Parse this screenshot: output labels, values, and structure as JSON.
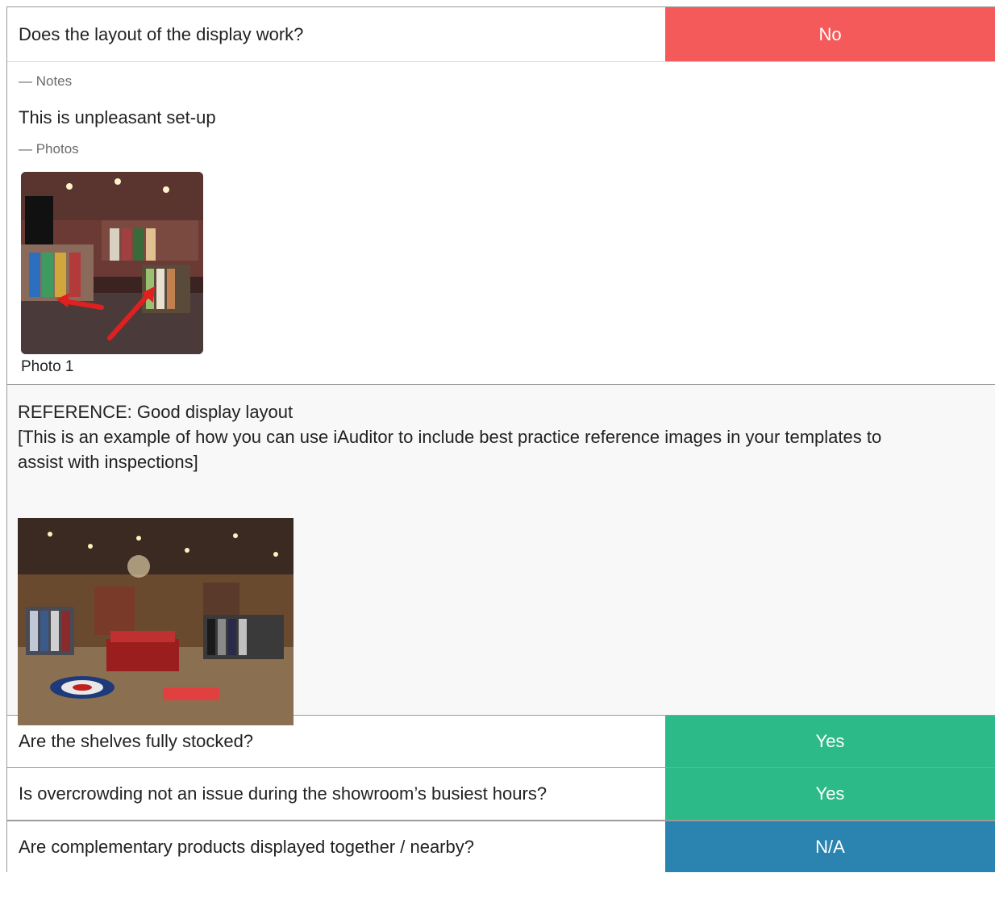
{
  "questions": [
    {
      "text": "Does the layout of the display work?",
      "answer": "No",
      "answer_color": "#f55a5a"
    },
    {
      "text": "Are the shelves fully stocked?",
      "answer": "Yes",
      "answer_color": "#2bba88"
    },
    {
      "text": "Is overcrowding not an issue during the showroom’s busiest hours?",
      "answer": "Yes",
      "answer_color": "#2bba88"
    },
    {
      "text": "Are complementary products displayed together / nearby?",
      "answer": "N/A",
      "answer_color": "#2b84b0"
    }
  ],
  "detail": {
    "notes_label": "— Notes",
    "notes_text": "This is unpleasant set-up",
    "photos_label": "— Photos",
    "photo_caption": "Photo 1"
  },
  "reference": {
    "title": "REFERENCE: Good display layout",
    "body": "[This is an example of how you can use iAuditor to include best practice reference images in your templates to assist with inspections]"
  }
}
